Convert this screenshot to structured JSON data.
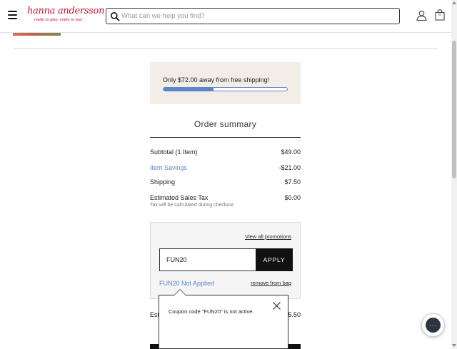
{
  "header": {
    "logo_script": "hanna andersson",
    "logo_tagline": "made to play. made to last.",
    "search_placeholder": "What can we help you find?",
    "bag_count": "0"
  },
  "shipping_banner": {
    "message": "Only $72.00 away from free shipping!",
    "progress_fraction": 0.405,
    "accent_color": "#5b87c8"
  },
  "order_summary": {
    "title": "Order summary",
    "rows": [
      {
        "label": "Subtotal (1 Item)",
        "value": "$49.00"
      },
      {
        "label": "Item Savings",
        "value": "-$21.00"
      },
      {
        "label": "Shipping",
        "value": "$7.50"
      },
      {
        "label": "Estimated Sales Tax",
        "value": "$0.00"
      }
    ],
    "tax_note": "Tax will be calculated during checkout",
    "estimated_total_label": "Esti",
    "estimated_total_value": "5.50"
  },
  "promo": {
    "view_all": "View all promotions",
    "code_value": "FUN20",
    "apply_label": "APPLY",
    "status_text": "FUN20 Not Applied",
    "remove_label": "remove from bag"
  },
  "tooltip": {
    "message": "Coupon code \"FUN20\" is not active."
  },
  "chat": {
    "dots": "..."
  }
}
